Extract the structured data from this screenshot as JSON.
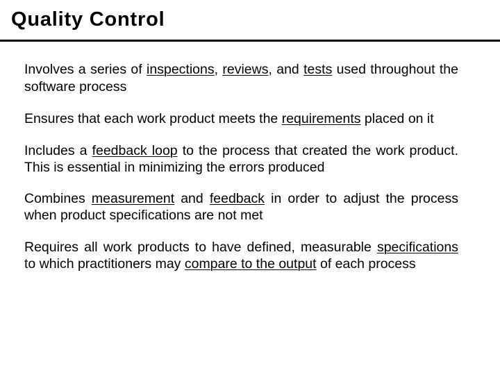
{
  "slide": {
    "title": "Quality Control",
    "paragraphs": [
      {
        "id": "p1",
        "segments": [
          {
            "text": "Involves a series of ",
            "underline": false
          },
          {
            "text": "inspections",
            "underline": true
          },
          {
            "text": ", ",
            "underline": false
          },
          {
            "text": "reviews",
            "underline": true
          },
          {
            "text": ", and ",
            "underline": false
          },
          {
            "text": "tests",
            "underline": true
          },
          {
            "text": " used throughout the software process",
            "underline": false
          }
        ],
        "plain": "Involves a series of inspections, reviews, and tests used throughout the software process"
      },
      {
        "id": "p2",
        "segments": [
          {
            "text": "Ensures that each work product meets the ",
            "underline": false
          },
          {
            "text": "requirements",
            "underline": true
          },
          {
            "text": " placed on it",
            "underline": false
          }
        ],
        "plain": "Ensures that each work product meets the requirements placed on it"
      },
      {
        "id": "p3",
        "segments": [
          {
            "text": "Includes a ",
            "underline": false
          },
          {
            "text": "feedback loop",
            "underline": true
          },
          {
            "text": " to the process that created the work product. This is essential in minimizing the errors produced",
            "underline": false
          }
        ],
        "plain": "Includes a feedback loop to the process that created the work product. This is essential in minimizing the errors produced"
      },
      {
        "id": "p4",
        "segments": [
          {
            "text": "Combines ",
            "underline": false
          },
          {
            "text": "measurement",
            "underline": true
          },
          {
            "text": " and ",
            "underline": false
          },
          {
            "text": "feedback",
            "underline": true
          },
          {
            "text": " in order to adjust the process when product specifications are not met",
            "underline": false
          }
        ],
        "plain": "Combines measurement and feedback in order to adjust the process when product specifications are not met"
      },
      {
        "id": "p5",
        "segments": [
          {
            "text": "Requires all work products to have defined, measurable ",
            "underline": false
          },
          {
            "text": "specifications",
            "underline": true
          },
          {
            "text": " to which practitioners may ",
            "underline": false
          },
          {
            "text": "compare to the output",
            "underline": true
          },
          {
            "text": " of each process",
            "underline": false
          }
        ],
        "plain": "Requires all work products to have defined, measurable specifications to which practitioners may compare to the output of each process"
      }
    ],
    "colors": {
      "background": "#ffffff",
      "text": "#000000",
      "rule": "#000000"
    }
  }
}
